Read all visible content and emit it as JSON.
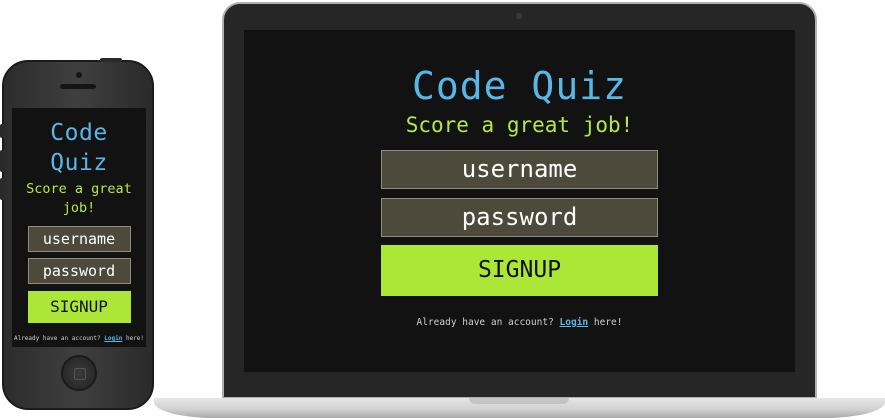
{
  "app": {
    "title": "Code Quiz",
    "subtitle": "Score a great job!"
  },
  "form": {
    "username_label": "username",
    "password_label": "password",
    "signup_label": "SIGNUP"
  },
  "footer": {
    "prefix": "Already have an account?",
    "link": "Login",
    "suffix": "here!"
  },
  "colors": {
    "background": "#121212",
    "title": "#59b7e6",
    "subtitle": "#b6e841",
    "field": "#4d4a3c",
    "button": "#ace637"
  }
}
